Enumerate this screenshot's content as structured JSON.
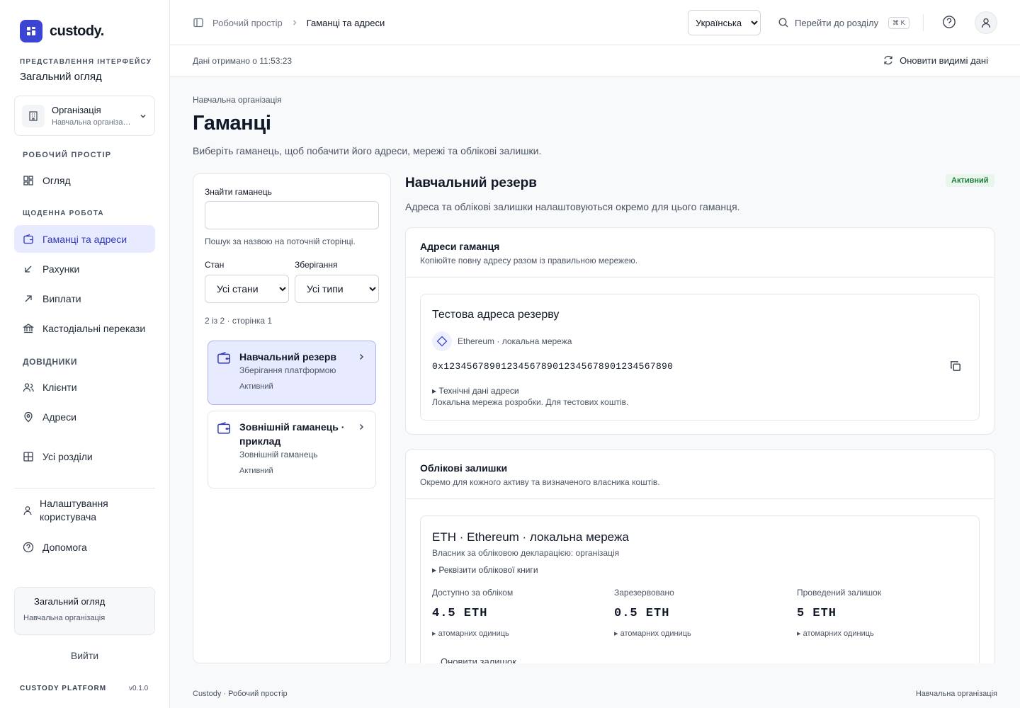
{
  "brand": {
    "name": "custody."
  },
  "sidebar": {
    "view_label": "ПРЕДСТАВЛЕННЯ ІНТЕРФЕЙСУ",
    "view_value": "Загальний огляд",
    "org": {
      "title": "Організація",
      "subtitle": "Навчальна організація"
    },
    "sections": {
      "workspace": "РОБОЧИЙ ПРОСТІР",
      "daily": "ЩОДЕННА РОБОТА",
      "refs": "ДОВІДНИКИ"
    },
    "items": {
      "overview": "Огляд",
      "wallets": "Гаманці та адреси",
      "accounts": "Рахунки",
      "payouts": "Виплати",
      "custody": "Кастодіальні перекази",
      "clients": "Клієнти",
      "addresses": "Адреси",
      "all": "Усі розділи",
      "user_settings": "Налаштування користувача",
      "help": "Допомога"
    },
    "user_card": {
      "title": "Загальний огляд",
      "subtitle": "Навчальна організація"
    },
    "logout": "Вийти",
    "platform": "CUSTODY PLATFORM",
    "version": "v0.1.0"
  },
  "header": {
    "breadcrumb": [
      "Робочий простір",
      "Гаманці та адреси"
    ],
    "language": "Українська",
    "search": "Перейти до розділу",
    "shortcut": "⌘ K"
  },
  "subbar": {
    "fetched": "Дані отримано о 11:53:23",
    "refresh": "Оновити видимі дані"
  },
  "page": {
    "eyebrow": "Навчальна організація",
    "title": "Гаманці",
    "description": "Виберіть гаманець, щоб побачити його адреси, мережі та облікові залишки."
  },
  "filters": {
    "search_label": "Знайти гаманець",
    "search_value": "",
    "search_hint": "Пошук за назвою на поточній сторінці.",
    "state_label": "Стан",
    "state_value": "Усі стани",
    "storage_label": "Зберігання",
    "storage_value": "Усі типи",
    "count": "2 із 2 · сторінка 1"
  },
  "wallets": [
    {
      "name": "Навчальний резерв",
      "type": "Зберігання платформою",
      "status": "Активний"
    },
    {
      "name": "Зовнішній гаманець · приклад",
      "type": "Зовнішній гаманець",
      "status": "Активний"
    }
  ],
  "detail": {
    "title": "Навчальний резерв",
    "badge": "Активний",
    "description": "Адреса та облікові залишки налаштовуються окремо для цього гаманця.",
    "addresses": {
      "title": "Адреси гаманця",
      "subtitle": "Копіюйте повну адресу разом із правильною мережею.",
      "item": {
        "title": "Тестова адреса резерву",
        "network": "Ethereum · локальна мережа",
        "address": "0x1234567890123456789012345678901234567890",
        "tech": "Технічні дані адреси",
        "note": "Локальна мережа розробки. Для тестових коштів."
      }
    },
    "balances": {
      "title": "Облікові залишки",
      "subtitle": "Окремо для кожного активу та визначеного власника коштів.",
      "item": {
        "title": "ETH · Ethereum · локальна мережа",
        "owner": "Власник за обліковою декларацією: організація",
        "requisites": "Реквізити облікової книги",
        "available_label": "Доступно за обліком",
        "available_value": "4.5 ETH",
        "reserved_label": "Зарезервовано",
        "reserved_value": "0.5 ETH",
        "posted_label": "Проведений залишок",
        "posted_value": "5 ETH",
        "atomic": "атомарних одиниць",
        "refresh": "Оновити залишок"
      }
    }
  },
  "footer": {
    "left": "Custody · Робочий простір",
    "right": "Навчальна організація"
  },
  "colors": {
    "accent": "#3b45d4",
    "active_bg": "#e8ebff",
    "success": "#1e7a3c"
  }
}
